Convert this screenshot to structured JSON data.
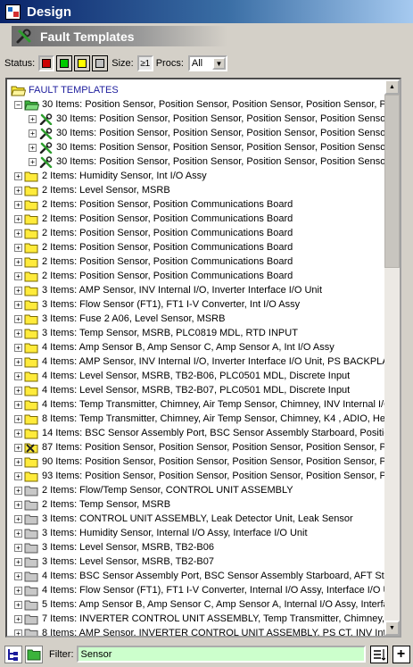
{
  "window": {
    "title": "Design"
  },
  "panel": {
    "title": "Fault Templates"
  },
  "toolbar": {
    "status_label": "Status:",
    "status_swatches": [
      {
        "name": "red",
        "color": "#cc0000"
      },
      {
        "name": "green",
        "color": "#00cc00"
      },
      {
        "name": "yellow",
        "color": "#ffff00"
      },
      {
        "name": "gray",
        "color": "#c0c0c0"
      }
    ],
    "size_label": "Size:",
    "size_button_text": "≥1",
    "procs_label": "Procs:",
    "procs_value": "All"
  },
  "tree": {
    "root_label": "FAULT TEMPLATES",
    "items": [
      {
        "text": "30 Items: Position  Sensor, Position  Sensor, Position  Sensor, Position  Sensor, P",
        "level": 1,
        "icon": "green-folder-open-icon",
        "expander": "−"
      },
      {
        "text": "30 Items: Position  Sensor, Position  Sensor, Position  Sensor, Position  Sensor, Position  Senso",
        "level": 2,
        "icon": "wrench-icon",
        "expander": "+"
      },
      {
        "text": "30 Items: Position  Sensor, Position  Sensor, Position  Sensor, Position  Sensor, Position  Senso",
        "level": 2,
        "icon": "wrench-icon",
        "expander": "+"
      },
      {
        "text": "30 Items: Position  Sensor, Position  Sensor, Position  Sensor, Position  Sensor, Position  Senso",
        "level": 2,
        "icon": "wrench-icon",
        "expander": "+"
      },
      {
        "text": "30 Items: Position  Sensor, Position  Sensor, Position  Sensor, Position  Sensor, Position  Senso",
        "level": 2,
        "icon": "wrench-icon",
        "expander": "+"
      },
      {
        "text": "2 Items: Humidity Sensor, Int I/O Assy",
        "level": 1,
        "icon": "yellow-folder-icon",
        "expander": "+"
      },
      {
        "text": "2 Items: Level Sensor, MSRB",
        "level": 1,
        "icon": "yellow-folder-icon",
        "expander": "+"
      },
      {
        "text": "2 Items: Position  Sensor, Position Communications Board",
        "level": 1,
        "icon": "yellow-folder-icon",
        "expander": "+"
      },
      {
        "text": "2 Items: Position  Sensor, Position Communications Board",
        "level": 1,
        "icon": "yellow-folder-icon",
        "expander": "+"
      },
      {
        "text": "2 Items: Position  Sensor, Position Communications Board",
        "level": 1,
        "icon": "yellow-folder-icon",
        "expander": "+"
      },
      {
        "text": "2 Items: Position  Sensor, Position Communications Board",
        "level": 1,
        "icon": "yellow-folder-icon",
        "expander": "+"
      },
      {
        "text": "2 Items: Position  Sensor, Position Communications Board",
        "level": 1,
        "icon": "yellow-folder-icon",
        "expander": "+"
      },
      {
        "text": "2 Items: Position  Sensor, Position Communications Board",
        "level": 1,
        "icon": "yellow-folder-icon",
        "expander": "+"
      },
      {
        "text": "3 Items: AMP Sensor, INV Internal I/O, Inverter Interface I/O Unit",
        "level": 1,
        "icon": "yellow-folder-icon",
        "expander": "+"
      },
      {
        "text": "3 Items: Flow Sensor (FT1), FT1 I-V Converter, Int I/O Assy",
        "level": 1,
        "icon": "yellow-folder-icon",
        "expander": "+"
      },
      {
        "text": "3 Items: Fuse 2 A06, Level Sensor, MSRB",
        "level": 1,
        "icon": "yellow-folder-icon",
        "expander": "+"
      },
      {
        "text": "3 Items: Temp Sensor, MSRB, PLC0819 MDL, RTD  INPUT",
        "level": 1,
        "icon": "yellow-folder-icon",
        "expander": "+"
      },
      {
        "text": "4 Items: Amp Sensor B, Amp Sensor C, Amp Sensor A, Int I/O Assy",
        "level": 1,
        "icon": "yellow-folder-icon",
        "expander": "+"
      },
      {
        "text": "4 Items: AMP Sensor, INV Internal I/O, Inverter Interface I/O Unit, PS BACKPLAN",
        "level": 1,
        "icon": "yellow-folder-icon",
        "expander": "+"
      },
      {
        "text": "4 Items: Level Sensor, MSRB, TB2-B06, PLC0501 MDL, Discrete Input",
        "level": 1,
        "icon": "yellow-folder-icon",
        "expander": "+"
      },
      {
        "text": "4 Items: Level Sensor, MSRB, TB2-B07, PLC0501 MDL, Discrete Input",
        "level": 1,
        "icon": "yellow-folder-icon",
        "expander": "+"
      },
      {
        "text": "4 Items: Temp Transmitter, Chimney, Air Temp Sensor, Chimney, INV Internal I/O,",
        "level": 1,
        "icon": "yellow-folder-icon",
        "expander": "+"
      },
      {
        "text": "8 Items: Temp Transmitter, Chimney, Air Temp Sensor, Chimney, K4 , ADIO, Heat",
        "level": 1,
        "icon": "yellow-folder-icon",
        "expander": "+"
      },
      {
        "text": "14 Items: BSC Sensor Assembly Port, BSC Sensor Assembly Starboard, Position C",
        "level": 1,
        "icon": "yellow-folder-icon",
        "expander": "+"
      },
      {
        "text": "87 Items: Position  Sensor, Position  Sensor, Position  Sensor, Position  Sensor, P",
        "level": 1,
        "icon": "crossed-tools-icon",
        "expander": "+"
      },
      {
        "text": "90 Items: Position  Sensor, Position  Sensor, Position  Sensor, Position  Sensor, P",
        "level": 1,
        "icon": "yellow-folder-icon",
        "expander": "+"
      },
      {
        "text": "93 Items: Position  Sensor, Position  Sensor, Position  Sensor, Position  Sensor, P",
        "level": 1,
        "icon": "yellow-folder-icon",
        "expander": "+"
      },
      {
        "text": "2 Items: Flow/Temp Sensor, CONTROL UNIT ASSEMBLY",
        "level": 1,
        "icon": "gray-folder-icon",
        "expander": "+"
      },
      {
        "text": "2 Items: Temp Sensor, MSRB",
        "level": 1,
        "icon": "gray-folder-icon",
        "expander": "+"
      },
      {
        "text": "3 Items: CONTROL UNIT ASSEMBLY, Leak Detector Unit, Leak Sensor",
        "level": 1,
        "icon": "gray-folder-icon",
        "expander": "+"
      },
      {
        "text": "3 Items: Humidity Sensor, Internal I/O Assy, Interface I/O Unit",
        "level": 1,
        "icon": "gray-folder-icon",
        "expander": "+"
      },
      {
        "text": "3 Items: Level Sensor, MSRB, TB2-B06",
        "level": 1,
        "icon": "gray-folder-icon",
        "expander": "+"
      },
      {
        "text": "3 Items: Level Sensor, MSRB, TB2-B07",
        "level": 1,
        "icon": "gray-folder-icon",
        "expander": "+"
      },
      {
        "text": "4 Items: BSC Sensor Assembly Port, BSC Sensor Assembly Starboard, AFT Stinge",
        "level": 1,
        "icon": "gray-folder-icon",
        "expander": "+"
      },
      {
        "text": "4 Items: Flow Sensor (FT1), FT1 I-V Converter, Internal I/O Assy, Interface I/O Ur",
        "level": 1,
        "icon": "gray-folder-icon",
        "expander": "+"
      },
      {
        "text": "5 Items: Amp Sensor B, Amp Sensor C, Amp Sensor A, Internal I/O Assy, Interfac",
        "level": 1,
        "icon": "gray-folder-icon",
        "expander": "+"
      },
      {
        "text": "7 Items: INVERTER CONTROL UNIT ASSEMBLY, Temp Transmitter, Chimney, A",
        "level": 1,
        "icon": "gray-folder-icon",
        "expander": "+"
      },
      {
        "text": "8 Items: AMP Sensor, INVERTER CONTROL UNIT ASSEMBLY, PS CT, INV Inter",
        "level": 1,
        "icon": "gray-folder-icon",
        "expander": "+"
      }
    ]
  },
  "filter": {
    "label": "Filter:",
    "value": "Sensor"
  },
  "colors": {
    "yellow_folder": "#ffeb3b",
    "green_folder": "#3bb33b",
    "gray_folder": "#c8c8c8",
    "filter_bg": "#ccffcc"
  }
}
